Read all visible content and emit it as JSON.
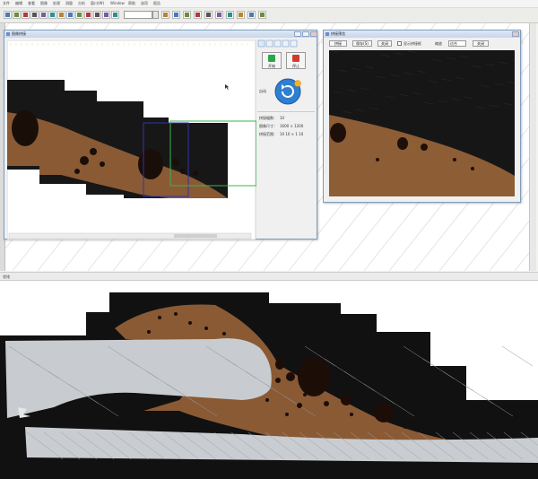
{
  "menubar": {
    "items": [
      "文件",
      "编辑",
      "查看",
      "图像",
      "处理",
      "测量",
      "分析",
      "窗口(W)",
      "Window",
      "帮助",
      "选项",
      "报告"
    ]
  },
  "toolbar": {
    "zoom_value": "",
    "icons": [
      "new-icon",
      "open-icon",
      "save-icon",
      "print-icon",
      "cut-icon",
      "copy-icon",
      "paste-icon",
      "camera-icon",
      "capture-icon",
      "image-icon",
      "zoom-in-icon",
      "zoom-out-icon",
      "fit-icon",
      "ruler-icon",
      "angle-icon",
      "area-icon",
      "count-icon",
      "grain-icon",
      "phase-icon",
      "report-icon",
      "excel-icon",
      "word-icon",
      "help-icon"
    ]
  },
  "status_bar": {
    "text": "就绪"
  },
  "stitch_window": {
    "title": "图像拼接",
    "start_label": "开始",
    "stop_label": "停止",
    "auto_label": "自动",
    "info": {
      "count_label": "拼接幅数：",
      "count_value": "10",
      "size_label": "图像尺寸：",
      "size_value": "1600 × 1200",
      "offset_label": "拼接范围：",
      "offset_value": "10 10 × 1 10"
    }
  },
  "preview_window": {
    "title": "拼接预览",
    "buttons": [
      "拼接",
      "保存(S)",
      "关闭"
    ],
    "checkbox_label": "显示拼接框",
    "combo_label": "缩放",
    "combo_value": "适合",
    "close_label": "关闭"
  },
  "colors": {
    "title_bar": "#c6d6ec",
    "window_border": "#7f9db9",
    "metal_dark": "#141414",
    "alloy_copper": "#8a5a34",
    "steel_light": "#c8ccd0",
    "green_frame": "#3ab54a",
    "blue_frame": "#3333aa"
  }
}
